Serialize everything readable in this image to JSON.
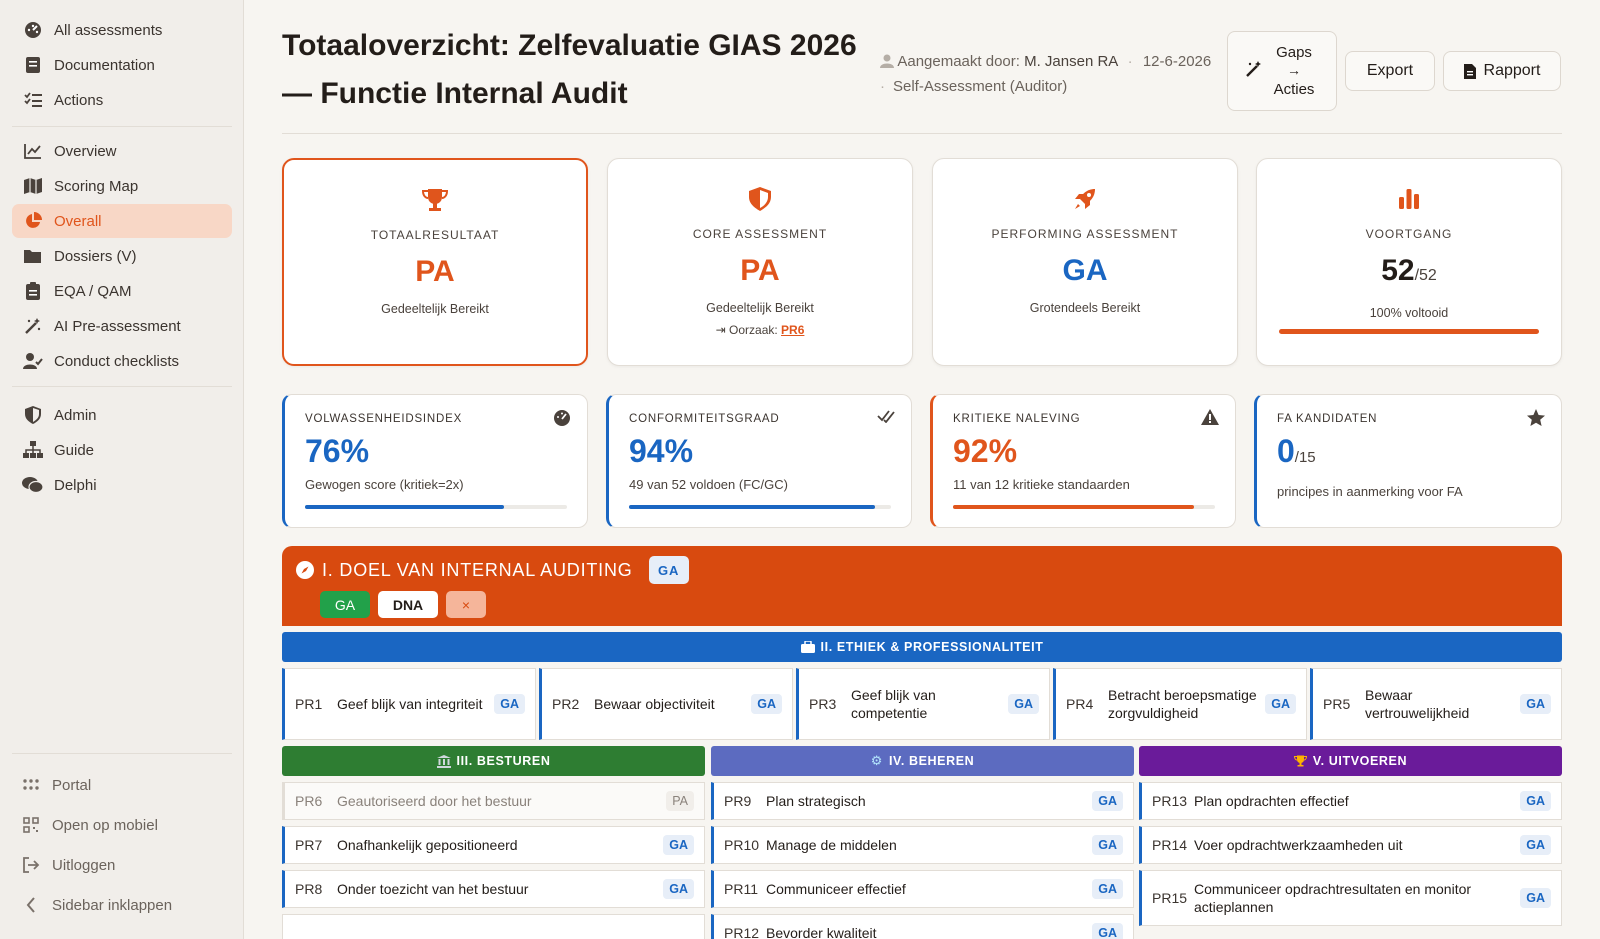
{
  "sidebar": {
    "items": [
      {
        "label": "All assessments",
        "icon": "dashboard-icon"
      },
      {
        "label": "Documentation",
        "icon": "book-icon"
      },
      {
        "label": "Actions",
        "icon": "list-check-icon"
      },
      {
        "label": "Overview",
        "icon": "chart-line-icon"
      },
      {
        "label": "Scoring Map",
        "icon": "map-icon"
      },
      {
        "label": "Overall",
        "icon": "pie-chart-icon",
        "active": true
      },
      {
        "label": "Dossiers (V)",
        "icon": "folder-icon"
      },
      {
        "label": "EQA / QAM",
        "icon": "clipboard-icon"
      },
      {
        "label": "AI Pre-assessment",
        "icon": "magic-wand-icon"
      },
      {
        "label": "Conduct checklists",
        "icon": "user-check-icon"
      },
      {
        "label": "Admin",
        "icon": "shield-icon"
      },
      {
        "label": "Guide",
        "icon": "sitemap-icon"
      },
      {
        "label": "Delphi",
        "icon": "comments-icon"
      }
    ],
    "footer": [
      {
        "label": "Portal",
        "icon": "grid-icon"
      },
      {
        "label": "Open op mobiel",
        "icon": "qr-code-icon"
      },
      {
        "label": "Uitloggen",
        "icon": "logout-icon"
      },
      {
        "label": "Sidebar inklappen",
        "icon": "chevron-left-icon"
      }
    ]
  },
  "header": {
    "title": "Totaaloverzicht: Zelfevaluatie GIAS 2026 — Functie Internal Audit",
    "created_by_label": "Aangemaakt door:",
    "created_by": "M. Jansen RA",
    "date": "12-6-2026",
    "type": "Self-Assessment (Auditor)",
    "gaps_line1": "Gaps",
    "gaps_arrow": "→",
    "gaps_line2": "Acties",
    "export": "Export",
    "rapport": "Rapport"
  },
  "cards": [
    {
      "label": "TOTAALRESULTAAT",
      "value": "PA",
      "sub": "Gedeeltelijk Bereikt",
      "icon": "trophy-icon",
      "color": "#e0551c"
    },
    {
      "label": "CORE ASSESSMENT",
      "value": "PA",
      "sub": "Gedeeltelijk Bereikt",
      "cause_label": "Oorzaak:",
      "cause_link": "PR6",
      "icon": "shield-half-icon",
      "color": "#e0551c"
    },
    {
      "label": "PERFORMING ASSESSMENT",
      "value": "GA",
      "sub": "Grotendeels Bereikt",
      "icon": "rocket-icon",
      "color": "#1a66c2"
    },
    {
      "label": "VOORTGANG",
      "value": "52",
      "value_total": "/52",
      "sub": "100% voltooid",
      "icon": "bar-chart-icon",
      "progress": 1.0,
      "color": "#e0551c"
    }
  ],
  "kpis": [
    {
      "label": "VOLWASSENHEIDSINDEX",
      "value": "76%",
      "sub": "Gewogen score (kritiek=2x)",
      "icon": "gauge-icon",
      "fill": 0.76,
      "color": "#1a66c2"
    },
    {
      "label": "CONFORMITEITSGRAAD",
      "value": "94%",
      "sub": "49 van 52 voldoen (FC/GC)",
      "icon": "double-check-icon",
      "fill": 0.94,
      "color": "#1a66c2"
    },
    {
      "label": "KRITIEKE NALEVING",
      "value": "92%",
      "sub": "11 van 12 kritieke standaarden",
      "icon": "warning-icon",
      "fill": 0.92,
      "color": "#e0551c"
    },
    {
      "label": "FA KANDIDATEN",
      "value": "0",
      "value_total": "/15",
      "sub": "principes in aanmerking voor FA",
      "icon": "star-icon",
      "color": "#1a66c2"
    }
  ],
  "domain1": {
    "title": "I. DOEL VAN INTERNAL AUDITING",
    "badge": "GA",
    "filters": [
      "GA",
      "DNA",
      "×"
    ]
  },
  "domain2": {
    "title": "II. ETHIEK & PROFESSIONALITEIT",
    "standards": [
      {
        "code": "PR1",
        "name": "Geef blijk van integriteit",
        "grade": "GA"
      },
      {
        "code": "PR2",
        "name": "Bewaar objectiviteit",
        "grade": "GA"
      },
      {
        "code": "PR3",
        "name": "Geef blijk van competentie",
        "grade": "GA"
      },
      {
        "code": "PR4",
        "name": "Betracht beroepsmatige zorgvuldigheid",
        "grade": "GA"
      },
      {
        "code": "PR5",
        "name": "Bewaar vertrouwelijkheid",
        "grade": "GA"
      }
    ]
  },
  "domain3": {
    "title": "III. BESTUREN",
    "standards": [
      {
        "code": "PR6",
        "name": "Geautoriseerd door het bestuur",
        "grade": "PA"
      },
      {
        "code": "PR7",
        "name": "Onafhankelijk gepositioneerd",
        "grade": "GA"
      },
      {
        "code": "PR8",
        "name": "Onder toezicht van het bestuur",
        "grade": "GA"
      }
    ]
  },
  "domain4": {
    "title": "IV. BEHEREN",
    "standards": [
      {
        "code": "PR9",
        "name": "Plan strategisch",
        "grade": "GA"
      },
      {
        "code": "PR10",
        "name": "Manage de middelen",
        "grade": "GA"
      },
      {
        "code": "PR11",
        "name": "Communiceer effectief",
        "grade": "GA"
      },
      {
        "code": "PR12",
        "name": "Bevorder kwaliteit",
        "grade": "GA"
      }
    ]
  },
  "domain5": {
    "title": "V. UITVOEREN",
    "standards": [
      {
        "code": "PR13",
        "name": "Plan opdrachten effectief",
        "grade": "GA"
      },
      {
        "code": "PR14",
        "name": "Voer opdrachtwerkzaamheden uit",
        "grade": "GA"
      },
      {
        "code": "PR15",
        "name": "Communiceer opdrachtresultaten en monitor actieplannen",
        "grade": "GA"
      }
    ]
  },
  "colors": {
    "accent": "#e0551c",
    "blue": "#1a66c2",
    "green": "#2e7d32",
    "indigo": "#5c6bc0",
    "purple": "#6a1b9a"
  }
}
